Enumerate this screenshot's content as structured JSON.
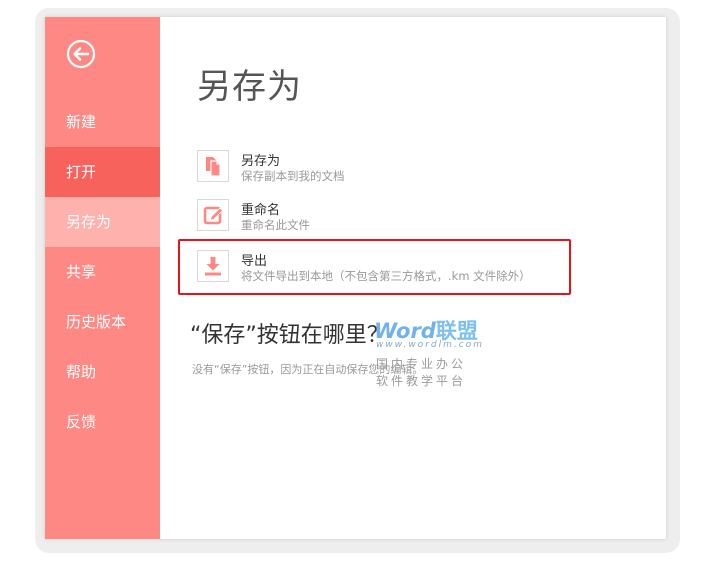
{
  "sidebar": {
    "back_icon": "arrow-left-circle-icon",
    "items": [
      {
        "label": "新建"
      },
      {
        "label": "打开"
      },
      {
        "label": "另存为"
      },
      {
        "label": "共享"
      },
      {
        "label": "历史版本"
      },
      {
        "label": "帮助"
      },
      {
        "label": "反馈"
      }
    ]
  },
  "main": {
    "title": "另存为",
    "options": [
      {
        "title": "另存为",
        "desc": "保存副本到我的文档",
        "icon": "copy-file-icon"
      },
      {
        "title": "重命名",
        "desc": "重命名此文件",
        "icon": "edit-icon"
      },
      {
        "title": "导出",
        "desc": "将文件导出到本地（不包含第三方格式，.km 文件除外）",
        "icon": "download-icon"
      }
    ],
    "where_title": "“保存”按钮在哪里？",
    "where_desc": "没有“保存”按钮，因为正在自动保存您的编辑。"
  },
  "watermark": {
    "brand": "Word",
    "brand_cn": "联盟",
    "url": "www.wordlm.com",
    "line1": "国内专业办公",
    "line2": "软件教学平台"
  },
  "colors": {
    "sidebar": "#fe8883",
    "sidebar_active": "#f7625c",
    "sidebar_selected": "#ffb1ae",
    "highlight": "#e8121a",
    "icon_accent": "#fe8883"
  }
}
